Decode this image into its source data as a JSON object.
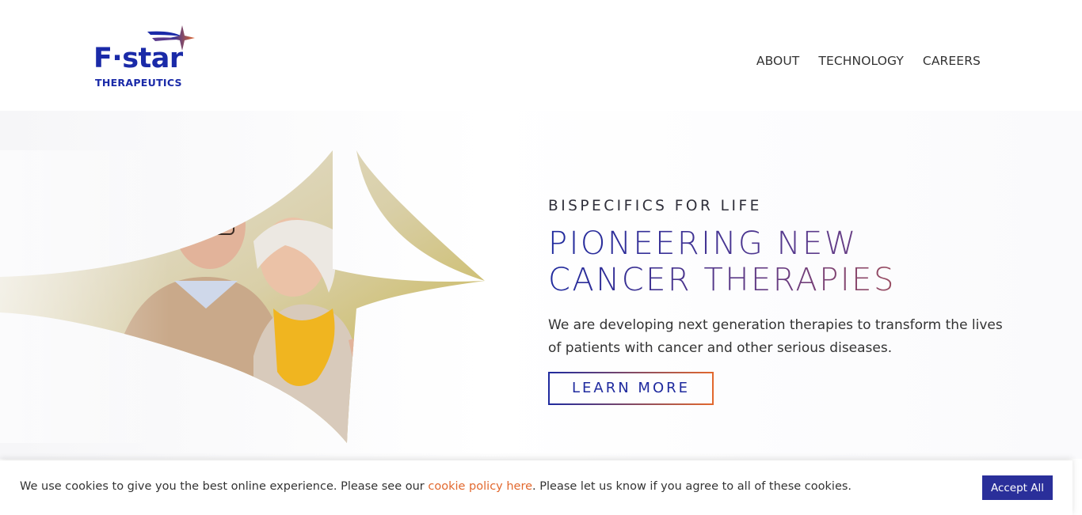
{
  "logo": {
    "wordmark": "F·star",
    "subtitle": "THERAPEUTICS"
  },
  "nav": {
    "items": [
      "ABOUT",
      "TECHNOLOGY",
      "CAREERS"
    ]
  },
  "hero": {
    "eyebrow": "BISPECIFICS FOR LIFE",
    "headline_line1": "PIONEERING NEW",
    "headline_line2": "CANCER THERAPIES",
    "description": "We are developing next generation therapies to transform the lives of patients with cancer and other serious diseases.",
    "cta_label": "LEARN MORE"
  },
  "cookie": {
    "text_before": "We use cookies to give you the best online experience. Please see our ",
    "link_text": "cookie policy here",
    "text_after": ". Please let us know if you agree to all of these cookies.",
    "accept_label": "Accept All"
  },
  "colors": {
    "brand_blue": "#1a2aa8",
    "accent_orange": "#e2682e",
    "button_bg": "#2a2f9a"
  }
}
